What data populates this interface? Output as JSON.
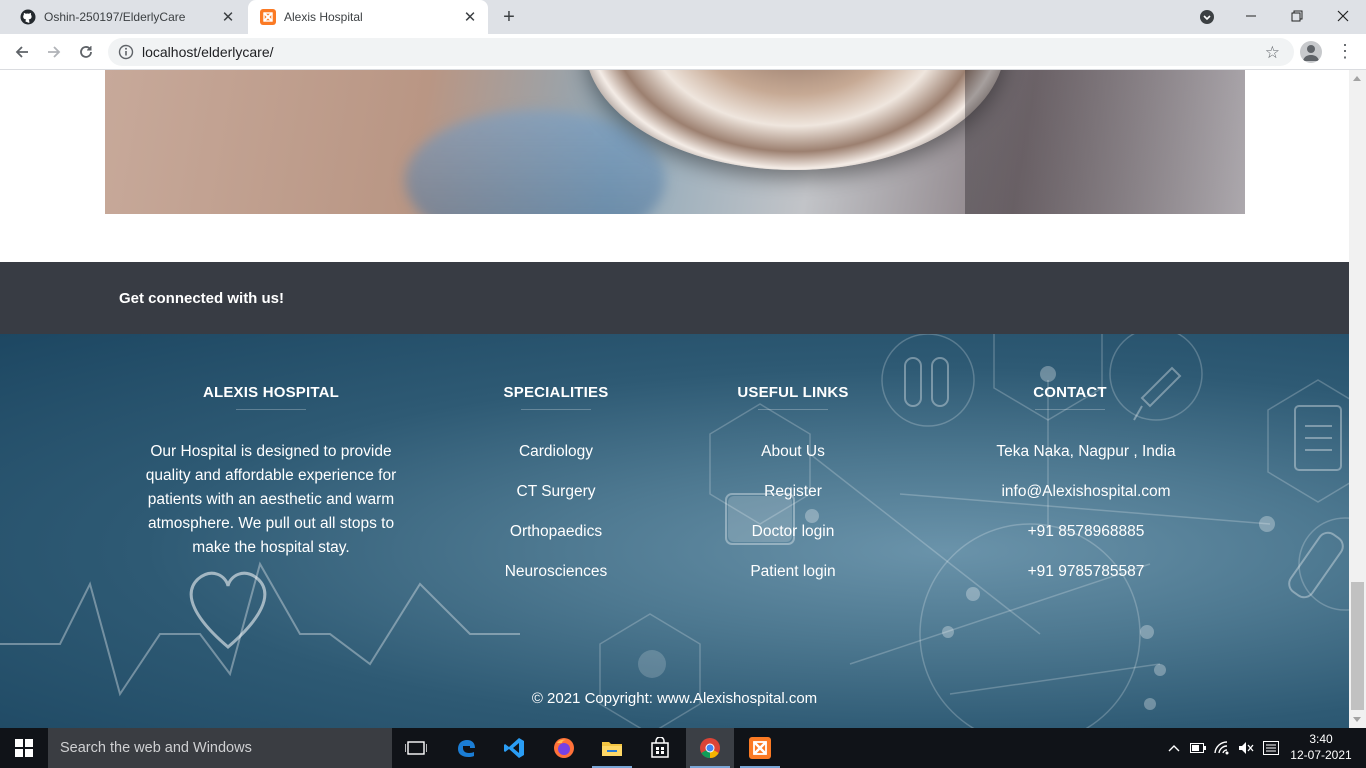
{
  "browser": {
    "tabs": [
      {
        "title": "Oshin-250197/ElderlyCare",
        "icon": "github-icon",
        "active": false
      },
      {
        "title": "Alexis Hospital",
        "icon": "xampp-icon",
        "active": true
      }
    ],
    "url": "localhost/elderlycare/"
  },
  "page": {
    "connect_text": "Get connected with us!",
    "footer": {
      "about": {
        "heading": "ALEXIS HOSPITAL",
        "text": "Our Hospital is designed to provide quality and affordable experience for patients with an aesthetic and warm atmosphere. We pull out all stops to make the hospital stay."
      },
      "specialities": {
        "heading": "SPECIALITIES",
        "items": [
          "Cardiology",
          "CT Surgery",
          "Orthopaedics",
          "Neurosciences"
        ]
      },
      "useful_links": {
        "heading": "USEFUL LINKS",
        "items": [
          "About Us",
          "Register",
          "Doctor login",
          "Patient login"
        ]
      },
      "contact": {
        "heading": "CONTACT",
        "items": [
          "Teka Naka, Nagpur , India",
          "info@Alexishospital.com",
          "+91 8578968885",
          "+91 9785785587"
        ]
      },
      "copyright": "© 2021 Copyright: www.Alexishospital.com"
    }
  },
  "taskbar": {
    "search_placeholder": "Search the web and Windows",
    "time": "3:40",
    "date": "12-07-2021"
  },
  "colors": {
    "connect_bar": "#383c44",
    "footer_bg": "#2e5a74",
    "taskbar": "#101318"
  }
}
